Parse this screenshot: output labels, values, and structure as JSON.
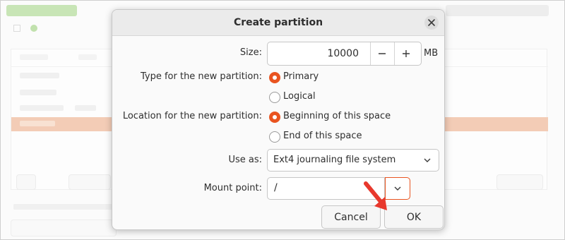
{
  "dialog": {
    "title": "Create partition",
    "close_icon": "close-icon",
    "size": {
      "label": "Size:",
      "value": "10000",
      "unit": "MB",
      "decrement_icon": "minus-icon",
      "increment_icon": "plus-icon"
    },
    "type": {
      "label": "Type for the new partition:",
      "options": [
        {
          "label": "Primary",
          "selected": true
        },
        {
          "label": "Logical",
          "selected": false
        }
      ]
    },
    "location": {
      "label": "Location for the new partition:",
      "options": [
        {
          "label": "Beginning of this space",
          "selected": true
        },
        {
          "label": "End of this space",
          "selected": false
        }
      ]
    },
    "use_as": {
      "label": "Use as:",
      "value": "Ext4 journaling file system",
      "dropdown_icon": "chevron-down-icon"
    },
    "mount_point": {
      "label": "Mount point:",
      "value": "/",
      "dropdown_icon": "chevron-down-icon"
    },
    "buttons": {
      "cancel": "Cancel",
      "ok": "OK"
    },
    "accent_color": "#e95420"
  },
  "annotation": {
    "arrow_icon": "red-arrow-icon",
    "color": "#e8382d"
  }
}
